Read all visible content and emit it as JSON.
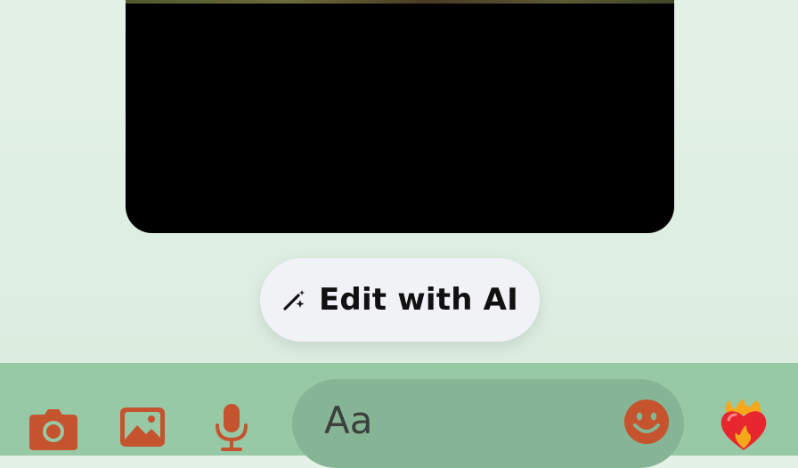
{
  "edit_ai": {
    "label": "Edit with AI",
    "icon": "magic-wand-sparkle-icon"
  },
  "composer": {
    "placeholder": "Aa",
    "icons": [
      "camera-icon",
      "photo-icon",
      "mic-icon",
      "emoji-icon",
      "heart-on-fire-icon"
    ]
  },
  "colors": {
    "background": "#e0efe4",
    "composer_bar": "#98c9a6",
    "message_field": "#86b595",
    "accent": "#c4532e",
    "button_bg": "#f1f2f6"
  }
}
